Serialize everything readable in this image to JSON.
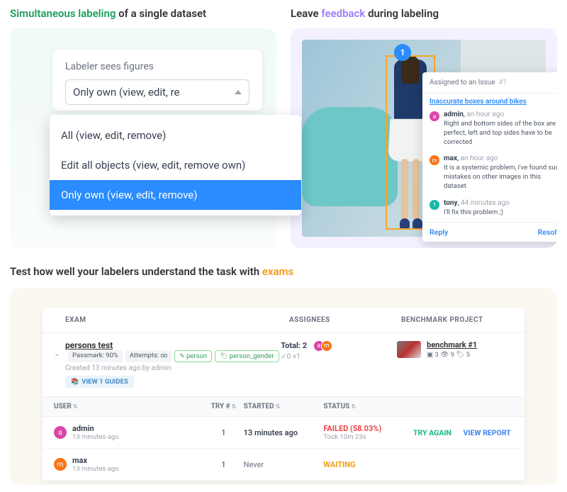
{
  "headlines": {
    "labeling_prefix": "Simultaneous labeling",
    "labeling_suffix": " of a single dataset",
    "feedback_prefix": "Leave ",
    "feedback_word": "feedback",
    "feedback_suffix": " during labeling",
    "exams_prefix": "Test how well your labelers understand the task with ",
    "exams_word": "exams"
  },
  "dropdown": {
    "label": "Labeler sees figures",
    "selected_short": "Only own (view, edit, re",
    "options": [
      "All (view, edit, remove)",
      "Edit all objects (view, edit, remove own)",
      "Only own (view, edit, remove)"
    ]
  },
  "annotation": {
    "badge": "1"
  },
  "issue": {
    "header": "Assigned to an Issue",
    "header_num": "#1",
    "title": "Inaccurate boxes around bikes",
    "comments": [
      {
        "user": "admin",
        "time": "an hour ago",
        "text": "Right and bottom sides of the box are perfect, left and top sides have to be corrected",
        "avatar_class": "av-pink",
        "initial": "a",
        "editable": true
      },
      {
        "user": "max",
        "time": "an hour ago",
        "text": "It is a systemic problem, i've found such mistakes on other images in this dataset",
        "avatar_class": "av-orange",
        "initial": "m"
      },
      {
        "user": "tony",
        "time": "44 minutes ago",
        "text": "I'll fix this problem ;)",
        "avatar_class": "av-teal",
        "initial": "t"
      }
    ],
    "reply": "Reply",
    "resolve": "Resolve"
  },
  "exams": {
    "cols": {
      "exam": "EXAM",
      "assignees": "ASSIGNEES",
      "benchmark": "BENCHMARK PROJECT"
    },
    "exam_name": "persons test",
    "passmark": "Passmark: 90%",
    "attempts": "Attempts: ∞",
    "tag_person": "person",
    "tag_gender": "person_gender",
    "created": "Created 13 minutes ago by admin",
    "guides": "VIEW 1 GUIDES",
    "assignees_total": "Total: 2",
    "assignees_sub": "✓0  ×1",
    "benchmark_name": "benchmark #1",
    "benchmark_stats": "▣ 3  👁 9  🏷 5",
    "sub_cols": {
      "user": "USER",
      "try": "TRY #",
      "started": "STARTED",
      "status": "STATUS"
    },
    "rows": [
      {
        "avatar_class": "av-pink",
        "initial": "a",
        "user": "admin",
        "time": "13 minutes ago",
        "try": "1",
        "started": "13 minutes ago",
        "status": "FAILED (58.03%)",
        "status_sub": "Took 10m 23s",
        "failed": true,
        "try_again": "TRY AGAIN",
        "view_report": "VIEW REPORT"
      },
      {
        "avatar_class": "av-orange",
        "initial": "m",
        "user": "max",
        "time": "13 minutes ago",
        "try": "1",
        "started": "Never",
        "status": "WAITING",
        "failed": false
      }
    ]
  }
}
